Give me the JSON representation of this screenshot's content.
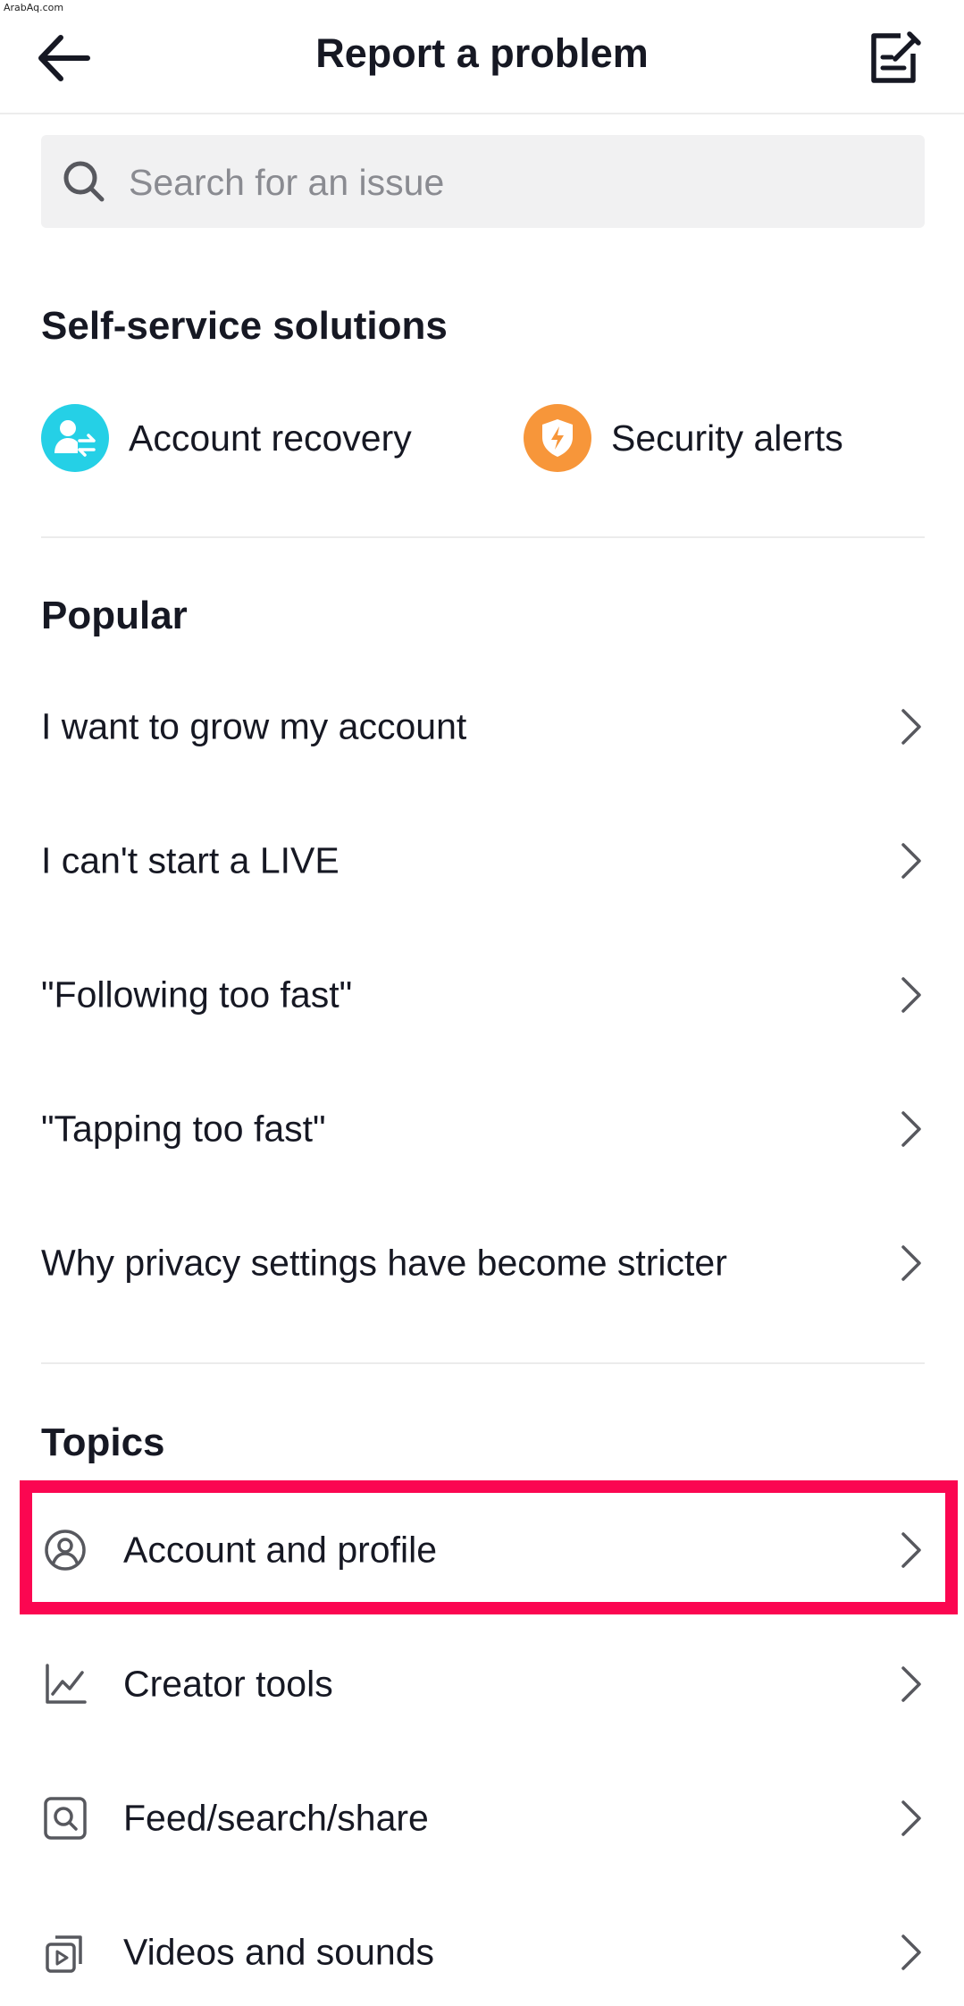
{
  "watermark": "ArabAq.com",
  "header": {
    "title": "Report a problem"
  },
  "search": {
    "placeholder": "Search for an issue"
  },
  "self_service": {
    "title": "Self-service solutions",
    "items": [
      {
        "label": "Account recovery",
        "icon": "account-recovery-icon",
        "color": "#25d0e6"
      },
      {
        "label": "Security alerts",
        "icon": "security-shield-icon",
        "color": "#f7963a"
      }
    ]
  },
  "popular": {
    "title": "Popular",
    "items": [
      {
        "label": "I want to grow my account"
      },
      {
        "label": "I can't start a LIVE"
      },
      {
        "label": "\"Following too fast\""
      },
      {
        "label": "\"Tapping too fast\""
      },
      {
        "label": "Why privacy settings have become stricter"
      }
    ]
  },
  "topics": {
    "title": "Topics",
    "items": [
      {
        "label": "Account and profile",
        "icon": "person-circle-icon",
        "highlighted": true
      },
      {
        "label": "Creator tools",
        "icon": "line-chart-icon"
      },
      {
        "label": "Feed/search/share",
        "icon": "search-box-icon"
      },
      {
        "label": "Videos and sounds",
        "icon": "video-stack-icon"
      }
    ]
  },
  "colors": {
    "highlight": "#fb0651",
    "text": "#161823",
    "muted": "#8a8b91"
  }
}
